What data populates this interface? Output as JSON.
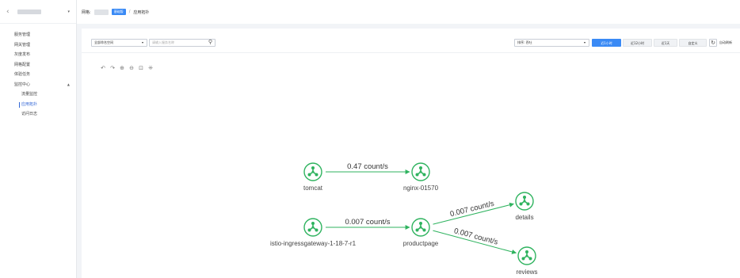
{
  "sidebar": {
    "back_glyph": "‹",
    "arrow_glyph": "▾",
    "items": [
      {
        "label": "服务管理"
      },
      {
        "label": "网关管理"
      },
      {
        "label": "灰度发布"
      },
      {
        "label": "网格配置"
      },
      {
        "label": "体验任务"
      },
      {
        "label": "监控中心",
        "caret": "▲"
      }
    ],
    "subitems": [
      {
        "label": "流量监控"
      },
      {
        "label": "应用拓扑",
        "active": true
      },
      {
        "label": "访问日志"
      }
    ]
  },
  "breadcrumb": {
    "label": "网格:",
    "badge": "基础版",
    "separator": "/",
    "current": "应用拓扑"
  },
  "filters": {
    "namespace": "全部命名空间",
    "search_placeholder": "请输入服务名称",
    "sort": "排序: 吞吐",
    "dropdown_glyph": "▾",
    "search_glyph": "⚲"
  },
  "time_buttons": [
    {
      "label": "近1小时",
      "active": true
    },
    {
      "label": "近12小时"
    },
    {
      "label": "近1天"
    },
    {
      "label": "自定义"
    }
  ],
  "refresh": {
    "glyph": "↻",
    "label": "自动刷新"
  },
  "toolbar_icons": [
    {
      "name": "undo-icon",
      "glyph": "↶"
    },
    {
      "name": "redo-icon",
      "glyph": "↷"
    },
    {
      "name": "zoom-in-icon",
      "glyph": "⊕"
    },
    {
      "name": "zoom-out-icon",
      "glyph": "⊖"
    },
    {
      "name": "fit-view-icon",
      "glyph": "⊡"
    },
    {
      "name": "layout-icon",
      "glyph": "⁜"
    }
  ],
  "colors": {
    "node": "#2fb35f",
    "edge": "#2fb35f",
    "accent": "#3a8af5"
  },
  "topology": {
    "nodes": [
      {
        "id": "tomcat",
        "label": "tomcat"
      },
      {
        "id": "nginx",
        "label": "nginx-01570"
      },
      {
        "id": "istio",
        "label": "istio-ingressgateway-1-18-7-r1"
      },
      {
        "id": "productpage",
        "label": "productpage"
      },
      {
        "id": "details",
        "label": "details"
      },
      {
        "id": "reviews",
        "label": "reviews"
      }
    ],
    "edges": [
      {
        "from": "tomcat",
        "to": "nginx",
        "label": "0.47 count/s"
      },
      {
        "from": "istio",
        "to": "productpage",
        "label": "0.007 count/s"
      },
      {
        "from": "productpage",
        "to": "details",
        "label": "0.007 count/s"
      },
      {
        "from": "productpage",
        "to": "reviews",
        "label": "0.007 count/s"
      }
    ]
  }
}
